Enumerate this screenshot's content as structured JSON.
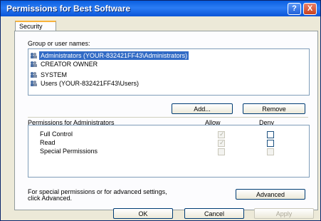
{
  "window": {
    "title": "Permissions for Best Software",
    "help_label": "?",
    "close_label": "X"
  },
  "tabs": [
    {
      "label": "Security",
      "active": true
    }
  ],
  "group_label": "Group or user names:",
  "users": [
    {
      "name": "Administrators (YOUR-832421FF43\\Administrators)",
      "selected": true,
      "icon": "user-group-icon"
    },
    {
      "name": "CREATOR OWNER",
      "selected": false,
      "icon": "user-group-icon"
    },
    {
      "name": "SYSTEM",
      "selected": false,
      "icon": "user-group-icon"
    },
    {
      "name": "Users (YOUR-832421FF43\\Users)",
      "selected": false,
      "icon": "user-group-icon"
    }
  ],
  "buttons": {
    "add": "Add...",
    "remove": "Remove",
    "advanced": "Advanced",
    "ok": "OK",
    "cancel": "Cancel",
    "apply": "Apply"
  },
  "permissions": {
    "header": "Permissions for Administrators",
    "allow_header": "Allow",
    "deny_header": "Deny",
    "rows": [
      {
        "name": "Full Control",
        "allow": true,
        "deny": false,
        "allow_disabled": true
      },
      {
        "name": "Read",
        "allow": true,
        "deny": false,
        "allow_disabled": true
      },
      {
        "name": "Special Permissions",
        "allow": false,
        "deny": false,
        "allow_disabled": true,
        "deny_disabled": true
      }
    ]
  },
  "advanced_note_line1": "For special permissions or for advanced settings,",
  "advanced_note_line2": "click Advanced.",
  "colors": {
    "titlebar": "#0b55d8",
    "selection": "#316ac5",
    "dialog_bg": "#ece9d8"
  }
}
